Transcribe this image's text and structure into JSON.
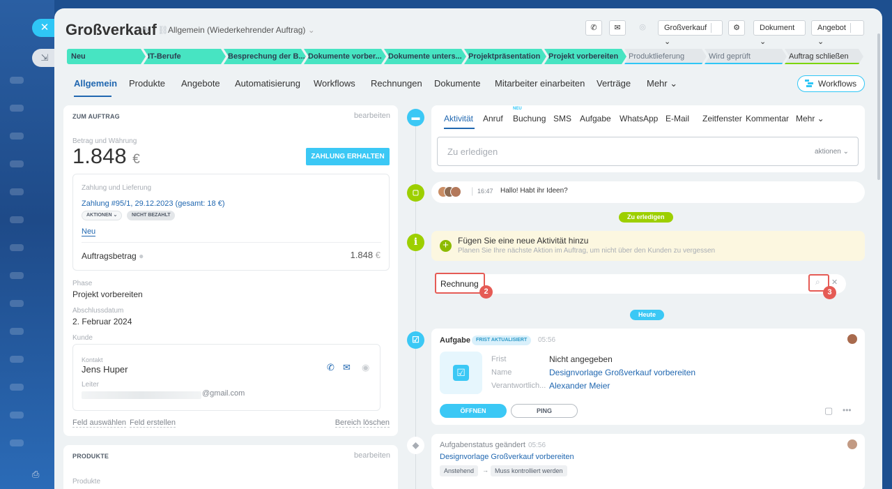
{
  "header": {
    "title": "Großverkauf",
    "pipeline": "Allgemein (Wiederkehrender Auftrag)",
    "toolbar": {
      "phone_icon": "phone-icon",
      "mail_icon": "mail-icon",
      "search_icon": "search-icon",
      "preset_select": "Großverkauf",
      "settings_icon": "gear-icon",
      "document_select": "Dokument",
      "offer_select": "Angebot"
    }
  },
  "stages": [
    {
      "label": "Neu"
    },
    {
      "label": "IT-Berufe"
    },
    {
      "label": "Besprechung der B..."
    },
    {
      "label": "Dokumente vorber..."
    },
    {
      "label": "Dokumente unters..."
    },
    {
      "label": "Projektpräsentation"
    },
    {
      "label": "Projekt vorbereiten"
    },
    {
      "label": "Produktlieferung"
    },
    {
      "label": "Wird geprüft"
    },
    {
      "label": "Auftrag schließen"
    }
  ],
  "tabs": [
    {
      "label": "Allgemein"
    },
    {
      "label": "Produkte"
    },
    {
      "label": "Angebote"
    },
    {
      "label": "Automatisierung"
    },
    {
      "label": "Workflows"
    },
    {
      "label": "Rechnungen"
    },
    {
      "label": "Dokumente"
    },
    {
      "label": "Mitarbeiter einarbeiten"
    },
    {
      "label": "Verträge"
    },
    {
      "label": "Mehr"
    }
  ],
  "workflows_button": "Workflows",
  "order_card": {
    "heading": "ZUM AUFTRAG",
    "edit": "bearbeiten",
    "amount_label": "Betrag und Währung",
    "amount": "1.848",
    "currency": "€",
    "pay_button": "ZAHLUNG ERHALTEN",
    "payment_section": "Zahlung und Lieferung",
    "payment_link": "Zahlung #95/1, 29.12.2023 (gesamt: 18 €)",
    "actions_pill": "AKTIONEN",
    "unpaid_pill": "NICHT BEZAHLT",
    "new_link": "Neu",
    "order_total_label": "Auftragsbetrag",
    "order_total": "1.848",
    "phase_label": "Phase",
    "phase": "Projekt vorbereiten",
    "close_date_label": "Abschlussdatum",
    "close_date": "2. Februar 2024",
    "customer_label": "Kunde",
    "contact_label": "Kontakt",
    "contact": "Jens Huper",
    "manager_label": "Leiter",
    "email_suffix": "@gmail.com",
    "select_field": "Feld auswählen",
    "create_field": "Feld erstellen",
    "clear_section": "Bereich löschen"
  },
  "products_card": {
    "heading": "PRODUKTE",
    "edit": "bearbeiten",
    "label": "Produkte"
  },
  "activity": {
    "tabs": [
      {
        "label": "Aktivität"
      },
      {
        "label": "Anruf"
      },
      {
        "label": "Buchung"
      },
      {
        "label": "SMS"
      },
      {
        "label": "Aufgabe"
      },
      {
        "label": "WhatsApp"
      },
      {
        "label": "E-Mail"
      },
      {
        "label": "Zeitfenster"
      },
      {
        "label": "Kommentar"
      },
      {
        "label": "Mehr"
      }
    ],
    "new_badge": "NEU",
    "todo_placeholder": "Zu erledigen",
    "actions_select": "aktionen"
  },
  "timeline": {
    "chat_time": "16:47",
    "chat_text": "Hallo! Habt ihr Ideen?",
    "todo_badge": "Zu erledigen",
    "add_title": "Fügen Sie eine neue Aktivität hinzu",
    "add_sub": "Planen Sie Ihre nächste Aktion im Auftrag, um nicht über den Kunden zu vergessen",
    "search_value": "Rechnung",
    "marker_2": "2",
    "marker_3": "3",
    "today_badge": "Heute",
    "task": {
      "title": "Aufgabe",
      "badge": "FRIST AKTUALISIERT",
      "time": "05:56",
      "deadline_label": "Frist",
      "deadline": "Nicht angegeben",
      "name_label": "Name",
      "name": "Designvorlage Großverkauf vorbereiten",
      "responsible_label": "Verantwortlich...",
      "responsible": "Alexander Meier",
      "open_button": "ÖFFNEN",
      "ping_button": "PING"
    },
    "status": {
      "title": "Aufgabenstatus geändert",
      "time": "05:56",
      "link": "Designvorlage Großverkauf vorbereiten",
      "from": "Anstehend",
      "arrow": "→",
      "to": "Muss kontrolliert werden"
    }
  },
  "colors": {
    "accent": "#2fc6f6",
    "link": "#2067b0",
    "stage_done": "#47e4c2",
    "marker": "#e55b55",
    "green": "#7bd500"
  }
}
